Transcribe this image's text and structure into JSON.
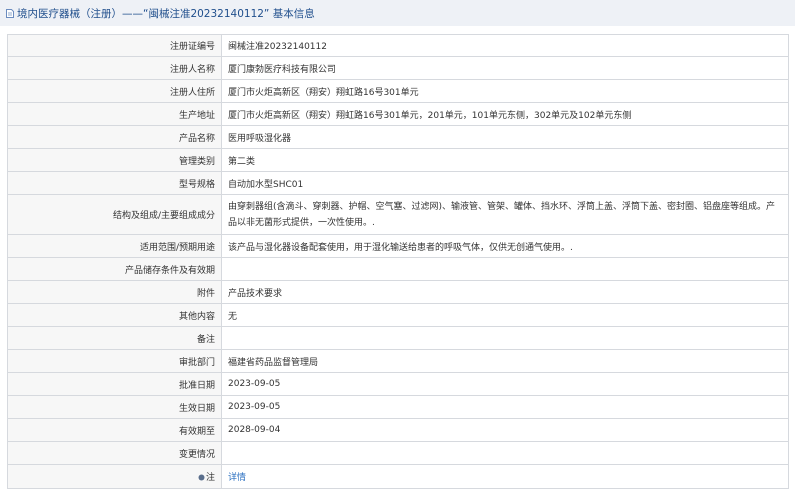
{
  "header": {
    "title": "境内医疗器械（注册）——“闽械注准20232140112” 基本信息"
  },
  "rows": [
    {
      "label": "注册证编号",
      "value": "闽械注准20232140112"
    },
    {
      "label": "注册人名称",
      "value": "厦门康勃医疗科技有限公司"
    },
    {
      "label": "注册人住所",
      "value": "厦门市火炬高新区（翔安）翔虹路16号301单元"
    },
    {
      "label": "生产地址",
      "value": "厦门市火炬高新区（翔安）翔虹路16号301单元，201单元，101单元东侧，302单元及102单元东侧"
    },
    {
      "label": "产品名称",
      "value": "医用呼吸湿化器"
    },
    {
      "label": "管理类别",
      "value": "第二类"
    },
    {
      "label": "型号规格",
      "value": "自动加水型SHC01"
    },
    {
      "label": "结构及组成/主要组成成分",
      "value": "由穿刺器组(含滴斗、穿刺器、护帽、空气塞、过滤网)、输液管、管架、罐体、挡水环、浮筒上盖、浮筒下盖、密封圈、铝盘座等组成。产品以非无菌形式提供，一次性使用。."
    },
    {
      "label": "适用范围/预期用途",
      "value": "该产品与湿化器设备配套使用，用于湿化输送给患者的呼吸气体，仅供无创通气使用。."
    },
    {
      "label": "产品储存条件及有效期",
      "value": ""
    },
    {
      "label": "附件",
      "value": "产品技术要求"
    },
    {
      "label": "其他内容",
      "value": "无"
    },
    {
      "label": "备注",
      "value": ""
    },
    {
      "label": "审批部门",
      "value": "福建省药品监督管理局"
    },
    {
      "label": "批准日期",
      "value": "2023-09-05"
    },
    {
      "label": "生效日期",
      "value": "2023-09-05"
    },
    {
      "label": "有效期至",
      "value": "2028-09-04"
    },
    {
      "label": "变更情况",
      "value": ""
    },
    {
      "label": "注",
      "value": "详情"
    }
  ]
}
